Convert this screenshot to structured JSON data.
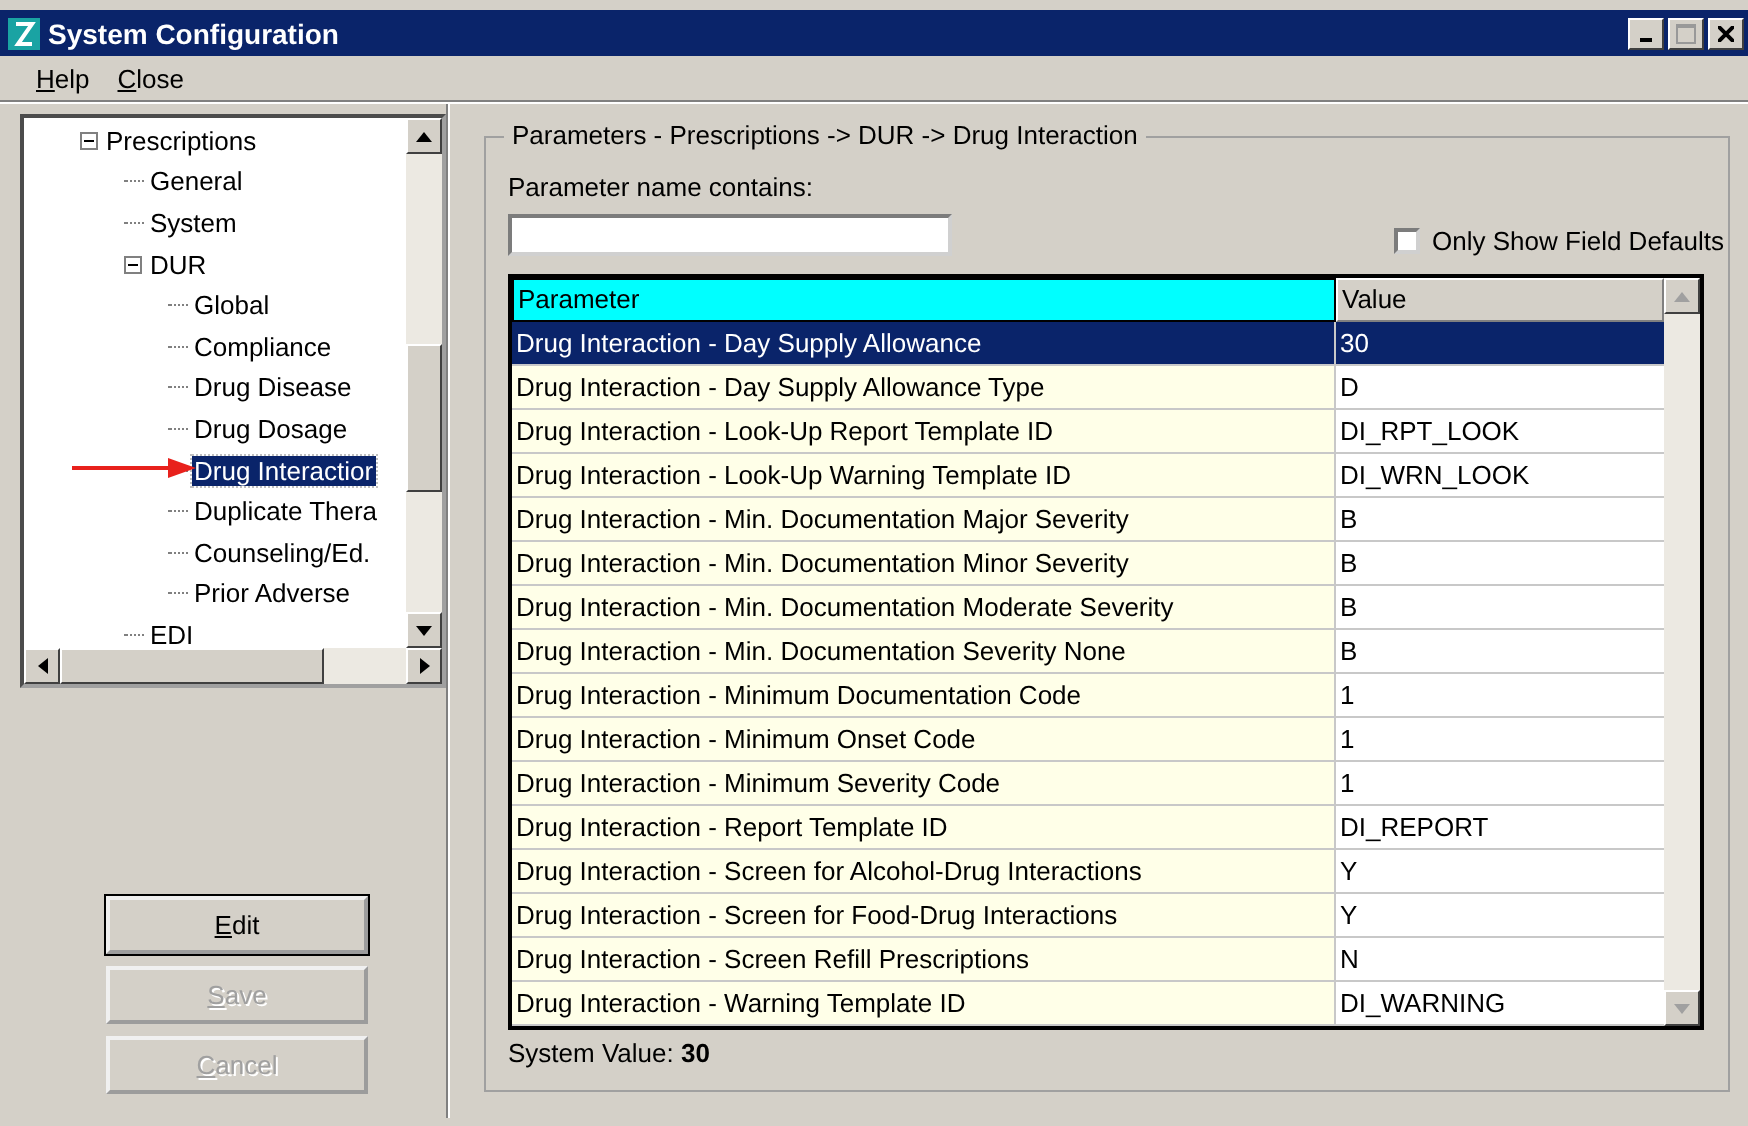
{
  "window": {
    "title": "System Configuration"
  },
  "menu": [
    "Help",
    "Close"
  ],
  "tree": [
    {
      "label": "Prescriptions",
      "expanded": true,
      "selected": false,
      "children": [
        {
          "label": "General",
          "selected": false
        },
        {
          "label": "System",
          "selected": false
        },
        {
          "label": "DUR",
          "expanded": true,
          "selected": false,
          "children": [
            {
              "label": "Global",
              "selected": false
            },
            {
              "label": "Compliance",
              "selected": false
            },
            {
              "label": "Drug Disease",
              "selected": false
            },
            {
              "label": "Drug Dosage",
              "selected": false
            },
            {
              "label": "Drug Interactior",
              "selected": true
            },
            {
              "label": "Duplicate Thera",
              "selected": false
            },
            {
              "label": "Counseling/Ed.",
              "selected": false
            },
            {
              "label": "Prior Adverse",
              "selected": false
            }
          ]
        },
        {
          "label": "EDI",
          "selected": false
        }
      ]
    }
  ],
  "buttons": [
    {
      "label": "Edit",
      "disabled": false
    },
    {
      "label": "Save",
      "disabled": true
    },
    {
      "label": "Cancel",
      "disabled": true
    }
  ],
  "group_title": "Parameters - Prescriptions -> DUR -> Drug Interaction",
  "filter": {
    "label": "Parameter name contains:"
  },
  "only_defaults": {
    "label": "Only Show Field Defaults",
    "checked": false
  },
  "table": {
    "columns": [
      "Parameter",
      "Value"
    ],
    "rows": [
      {
        "parameter": "Drug Interaction - Day Supply Allowance",
        "value": "30",
        "selected": true
      },
      {
        "parameter": "Drug Interaction - Day Supply Allowance Type",
        "value": "D",
        "selected": false
      },
      {
        "parameter": "Drug Interaction - Look-Up Report Template ID",
        "value": "DI_RPT_LOOK",
        "selected": false
      },
      {
        "parameter": "Drug Interaction - Look-Up Warning Template ID",
        "value": "DI_WRN_LOOK",
        "selected": false
      },
      {
        "parameter": "Drug Interaction - Min. Documentation Major Severity",
        "value": "B",
        "selected": false
      },
      {
        "parameter": "Drug Interaction - Min. Documentation Minor Severity",
        "value": "B",
        "selected": false
      },
      {
        "parameter": "Drug Interaction - Min. Documentation Moderate Severity",
        "value": "B",
        "selected": false
      },
      {
        "parameter": "Drug Interaction - Min. Documentation Severity None",
        "value": "B",
        "selected": false
      },
      {
        "parameter": "Drug Interaction - Minimum Documentation Code",
        "value": "1",
        "selected": false
      },
      {
        "parameter": "Drug Interaction - Minimum Onset Code",
        "value": "1",
        "selected": false
      },
      {
        "parameter": "Drug Interaction - Minimum Severity Code",
        "value": "1",
        "selected": false
      },
      {
        "parameter": "Drug Interaction - Report Template ID",
        "value": "DI_REPORT",
        "selected": false
      },
      {
        "parameter": "Drug Interaction - Screen for Alcohol-Drug Interactions",
        "value": "Y",
        "selected": false
      },
      {
        "parameter": "Drug Interaction - Screen for Food-Drug Interactions",
        "value": "Y",
        "selected": false
      },
      {
        "parameter": "Drug Interaction - Screen Refill Prescriptions",
        "value": "N",
        "selected": false
      },
      {
        "parameter": "Drug Interaction - Warning Template ID",
        "value": "DI_WARNING",
        "selected": false
      }
    ]
  },
  "system_value": "System Value: **30**"
}
